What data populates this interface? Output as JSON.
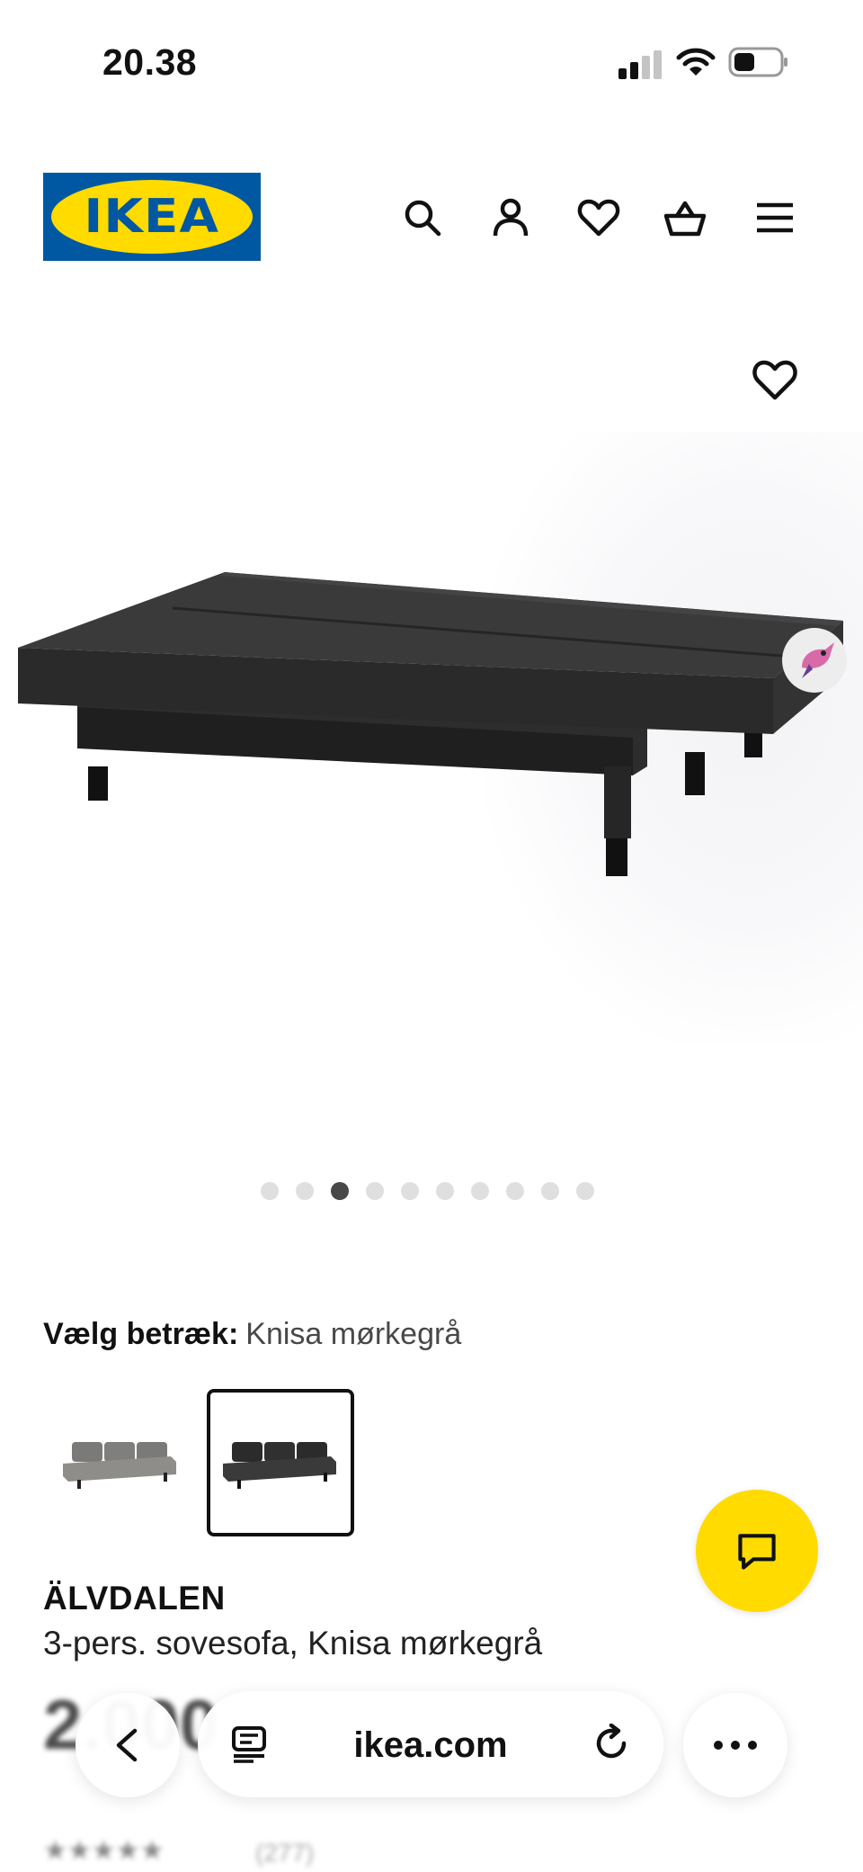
{
  "status": {
    "time": "20.38"
  },
  "header": {
    "logo_text": "IKEA",
    "brand_colors": {
      "blue": "#0058a3",
      "yellow": "#ffdb00"
    },
    "icons": [
      "search-icon",
      "account-icon",
      "heart-icon",
      "basket-icon",
      "menu-icon"
    ]
  },
  "gallery": {
    "image_count": 10,
    "active_index": 2
  },
  "variant": {
    "label": "Vælg betræk:",
    "value": "Knisa mørkegrå",
    "options": [
      "Knisa grå",
      "Knisa mørkegrå"
    ],
    "selected": 1
  },
  "product": {
    "name": "ÄLVDALEN",
    "description": "3-pers. sovesofa, Knisa mørkegrå",
    "price": "2.000",
    "rating_stars": "★★★★★",
    "review_count": "(277)"
  },
  "browser": {
    "url": "ikea.com"
  }
}
